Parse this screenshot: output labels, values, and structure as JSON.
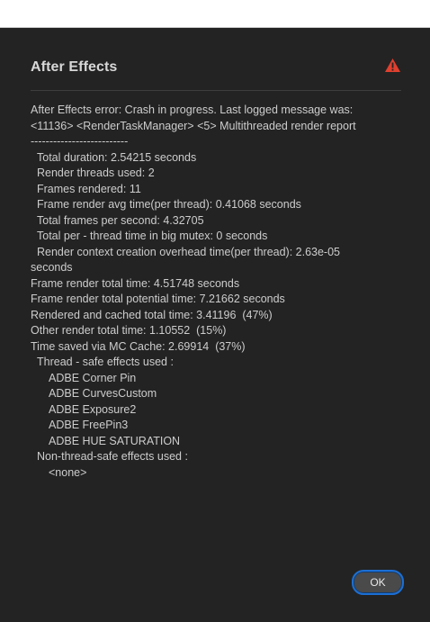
{
  "dialog": {
    "title": "After Effects",
    "warning_icon": "warning-triangle-icon",
    "warning_color": "#e0402f",
    "accent_color": "#1c6fd3",
    "message_lines": [
      {
        "text": "After Effects error: Crash in progress. Last logged message was:",
        "indent": 0
      },
      {
        "text": "<11136> <RenderTaskManager> <5> Multithreaded render report",
        "indent": 0
      },
      {
        "text": "--------------------------",
        "indent": 0
      },
      {
        "text": "Total duration: 2.54215 seconds",
        "indent": 1
      },
      {
        "text": "Render threads used: 2",
        "indent": 1
      },
      {
        "text": "Frames rendered: 11",
        "indent": 1
      },
      {
        "text": "Frame render avg time(per thread): 0.41068 seconds",
        "indent": 1
      },
      {
        "text": "Total frames per second: 4.32705",
        "indent": 1
      },
      {
        "text": "Total per - thread time in big mutex: 0 seconds",
        "indent": 1
      },
      {
        "text": "Render context creation overhead time(per thread): 2.63e-05",
        "indent": 1
      },
      {
        "text": "seconds",
        "indent": 0
      },
      {
        "text": "Frame render total time: 4.51748 seconds",
        "indent": 0
      },
      {
        "text": "Frame render total potential time: 7.21662 seconds",
        "indent": 0
      },
      {
        "text": "Rendered and cached total time: 3.41196  (47%)",
        "indent": 0
      },
      {
        "text": "Other render total time: 1.10552  (15%)",
        "indent": 0
      },
      {
        "text": "Time saved via MC Cache: 2.69914  (37%)",
        "indent": 0
      },
      {
        "text": "Thread - safe effects used :",
        "indent": 1
      },
      {
        "text": "ADBE Corner Pin",
        "indent": 2
      },
      {
        "text": "ADBE CurvesCustom",
        "indent": 2
      },
      {
        "text": "ADBE Exposure2",
        "indent": 2
      },
      {
        "text": "ADBE FreePin3",
        "indent": 2
      },
      {
        "text": "ADBE HUE SATURATION",
        "indent": 2
      },
      {
        "text": "Non-thread-safe effects used :",
        "indent": 1
      },
      {
        "text": "<none>",
        "indent": 2
      }
    ],
    "ok_label": "OK"
  }
}
